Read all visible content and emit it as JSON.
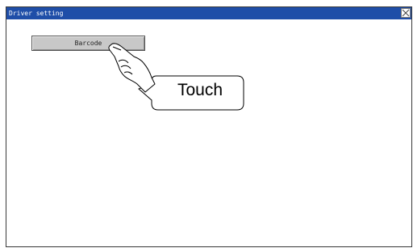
{
  "window": {
    "title": "Driver setting",
    "close_icon": "close-icon"
  },
  "main": {
    "barcode_button_label": "Barcode"
  },
  "annotation": {
    "callout_text": "Touch",
    "hand_icon": "pointing-hand-icon"
  },
  "colors": {
    "titlebar": "#1f4ea8",
    "button_face": "#c8c8c8"
  }
}
